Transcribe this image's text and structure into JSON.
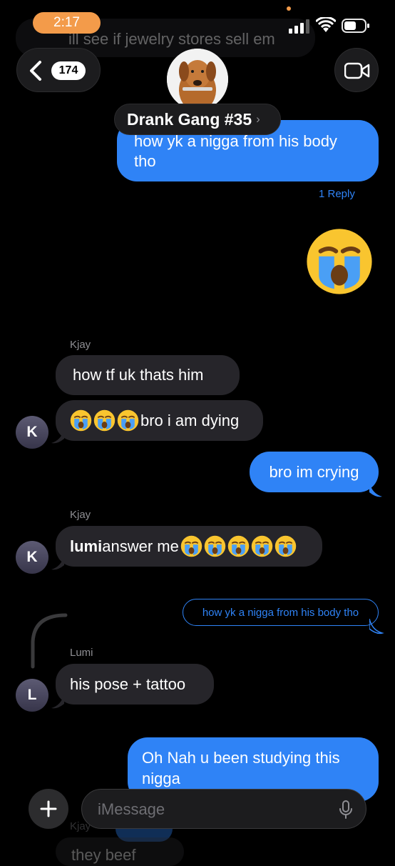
{
  "status_bar": {
    "time": "2:17"
  },
  "header": {
    "back_count": "174",
    "group_name": "Drank Gang #35"
  },
  "faded_top": {
    "text": "ill see if jewelry stores sell em"
  },
  "thread": {
    "msg_out_1": "how yk a nigga from his body tho",
    "reply_count": "1 Reply",
    "sender_kjay_1": "Kjay",
    "msg_kjay_1": "how tf uk thats him",
    "msg_kjay_2": "bro i am dying",
    "avatar_k": "K",
    "msg_out_2": "bro im crying",
    "sender_kjay_2": "Kjay",
    "msg_kjay_3_bold": "lumi",
    "msg_kjay_3_rest": " answer me",
    "quoted_reply": "how yk a nigga from his body tho",
    "sender_lumi": "Lumi",
    "msg_lumi": "his pose + tattoo",
    "avatar_l": "L",
    "msg_out_3": "Oh Nah u been studying this nigga",
    "bottom_sender": "Kjay",
    "bottom_faded": "they beef"
  },
  "composer": {
    "placeholder": "iMessage"
  },
  "colors": {
    "outgoing": "#2f83f6",
    "incoming": "#26252a",
    "time_pill": "#f39b4a"
  }
}
